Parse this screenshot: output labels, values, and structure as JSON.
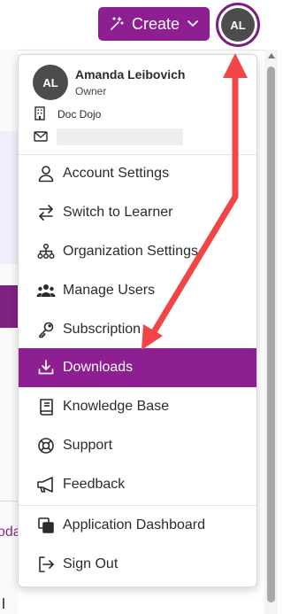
{
  "header": {
    "create_label": "Create",
    "avatar_initials": "AL",
    "brand_color": "#8e1f93"
  },
  "background": {
    "partial_text": "oda"
  },
  "user": {
    "initials": "AL",
    "name": "Amanda Leibovich",
    "role": "Owner",
    "organization": "Doc Dojo"
  },
  "menu": {
    "items": [
      {
        "label": "Account Settings",
        "icon": "user-icon"
      },
      {
        "label": "Switch to Learner",
        "icon": "switch-arrows-icon"
      },
      {
        "label": "Organization Settings",
        "icon": "org-chart-icon"
      },
      {
        "label": "Manage Users",
        "icon": "users-group-icon"
      },
      {
        "label": "Subscription",
        "icon": "key-icon"
      },
      {
        "label": "Downloads",
        "icon": "download-icon",
        "active": true
      },
      {
        "label": "Knowledge Base",
        "icon": "book-icon"
      },
      {
        "label": "Support",
        "icon": "lifebuoy-icon"
      },
      {
        "label": "Feedback",
        "icon": "megaphone-icon"
      },
      {
        "label": "Application Dashboard",
        "icon": "copy-windows-icon"
      },
      {
        "label": "Sign Out",
        "icon": "sign-out-icon"
      }
    ],
    "active_color": "#8e1f93"
  },
  "annotation": {
    "arrow_color": "#f24545"
  }
}
